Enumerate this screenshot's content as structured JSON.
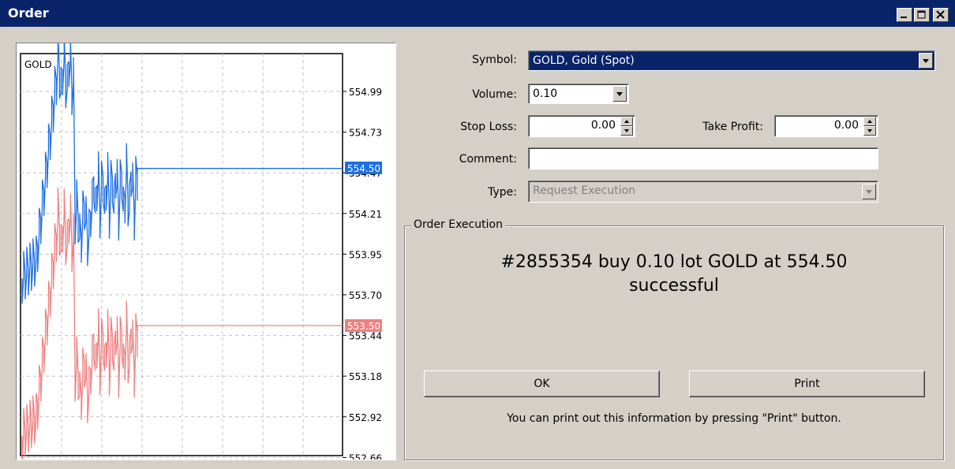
{
  "window": {
    "title": "Order"
  },
  "chart": {
    "symbol": "GOLD",
    "price_scale": [
      "554.99",
      "554.73",
      "554.47",
      "554.21",
      "553.95",
      "553.70",
      "553.44",
      "553.18",
      "552.92",
      "552.66"
    ],
    "ask": "554.50",
    "bid": "553.50",
    "colors": {
      "ask": "#1e6fe6",
      "bid": "#f08080",
      "grid": "#c0c0c0"
    }
  },
  "form": {
    "symbol_label": "Symbol:",
    "symbol_value": "GOLD, Gold (Spot)",
    "volume_label": "Volume:",
    "volume_value": "0.10",
    "stop_loss_label": "Stop Loss:",
    "stop_loss_value": "0.00",
    "take_profit_label": "Take Profit:",
    "take_profit_value": "0.00",
    "comment_label": "Comment:",
    "comment_value": "",
    "type_label": "Type:",
    "type_value": "Request Execution"
  },
  "execution": {
    "legend": "Order Execution",
    "line1": "#2855354 buy 0.10 lot GOLD at 554.50",
    "line2": "successful",
    "ok_label": "OK",
    "print_label": "Print",
    "note": "You can print out this information by pressing \"Print\" button."
  }
}
